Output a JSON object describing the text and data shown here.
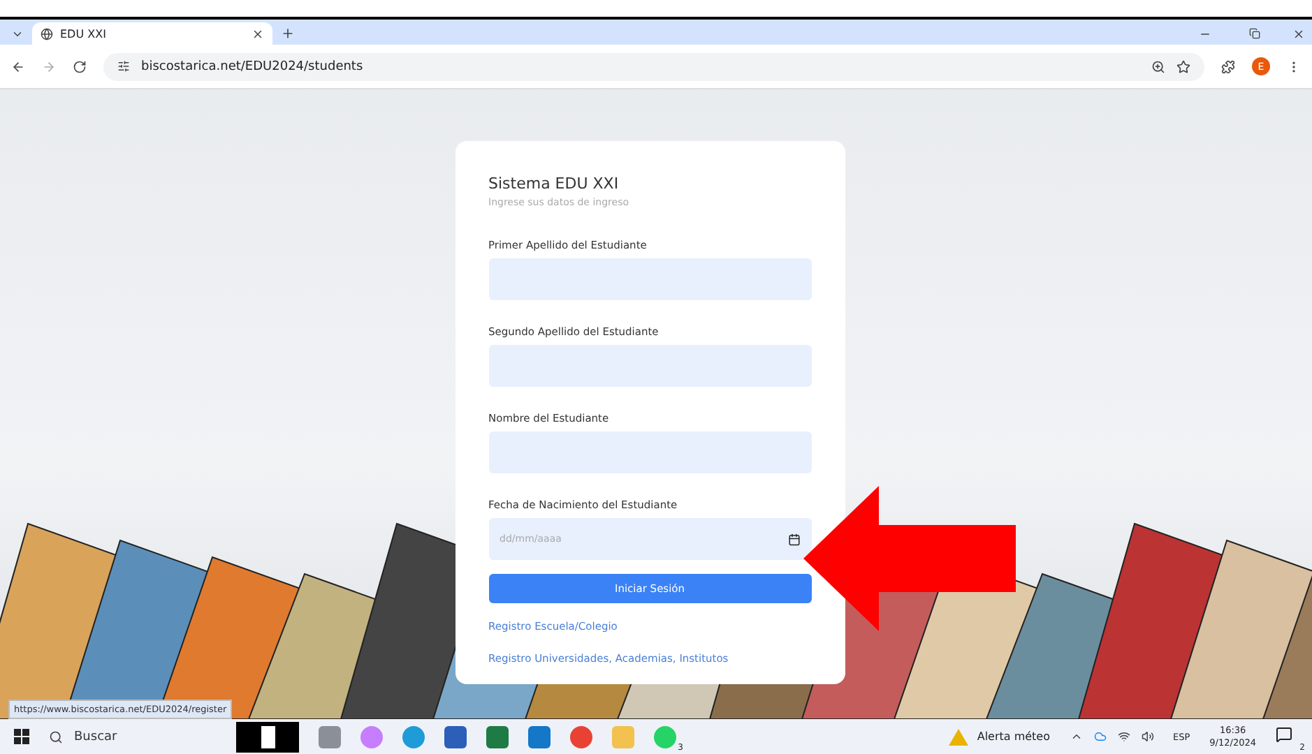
{
  "browser": {
    "tab": {
      "title": "EDU XXI",
      "selected": true
    },
    "address": "biscostarica.net/EDU2024/students",
    "profile_initial": "E"
  },
  "login_card": {
    "title": "Sistema EDU XXI",
    "subtitle": "Ingrese sus datos de ingreso",
    "fields": [
      {
        "label": "Primer Apellido del Estudiante",
        "kind": "text"
      },
      {
        "label": "Segundo Apellido del Estudiante",
        "kind": "text"
      },
      {
        "label": "Nombre del Estudiante",
        "kind": "text"
      },
      {
        "label": "Fecha de Nacimiento del Estudiante",
        "kind": "date",
        "placeholder": "dd/mm/aaaa"
      }
    ],
    "submit": "Iniciar Sesión",
    "links": [
      "Registro Escuela/Colegio",
      "Registro Universidades, Academias, Institutos"
    ]
  },
  "status_url": "https://www.biscostarica.net/EDU2024/register",
  "taskbar": {
    "search_placeholder": "Buscar",
    "whatsapp_badge": "3",
    "weather": "Alerta méteo",
    "language": "ESP",
    "time": "16:36",
    "date": "9/12/2024",
    "notifications": "2"
  }
}
